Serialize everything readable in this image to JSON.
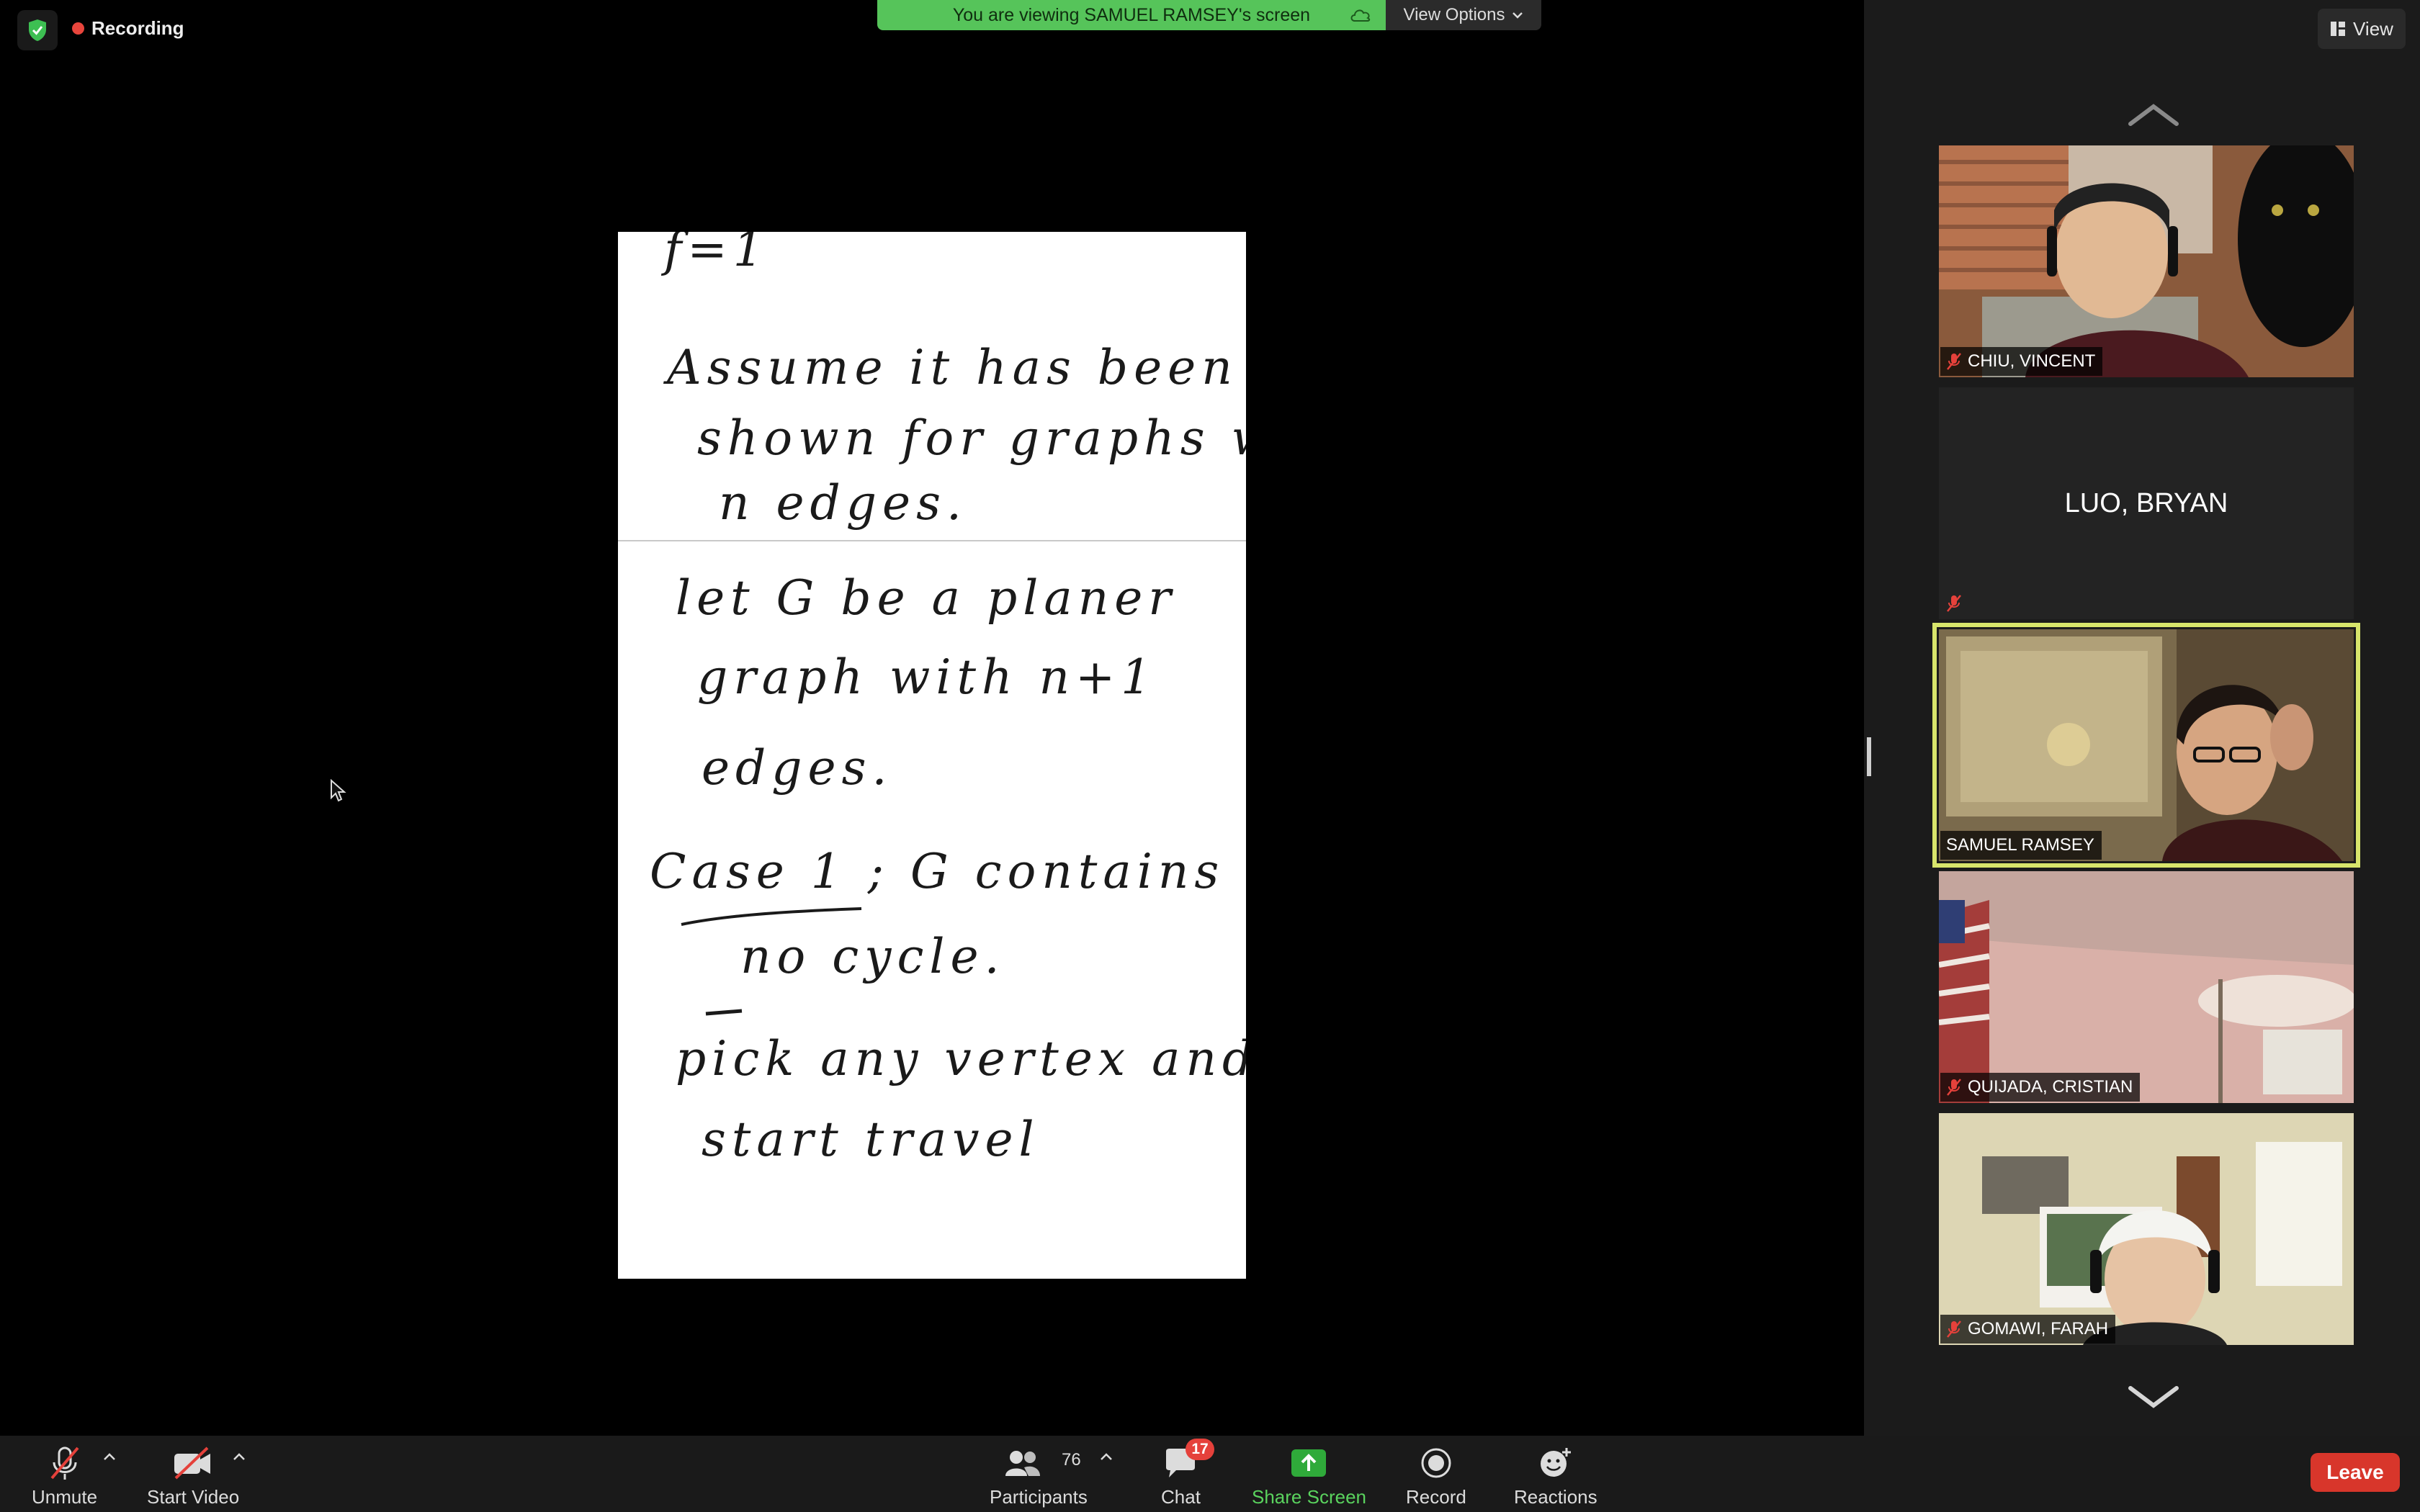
{
  "app": {
    "recording_label": "Recording",
    "banner_text": "You are viewing SAMUEL RAMSEY's screen",
    "view_options_label": "View Options",
    "view_button_label": "View"
  },
  "shared_screen": {
    "handwritten_lines": [
      "f=1",
      "Assume it has been",
      "shown for graphs with",
      "n edges.",
      "let G be a planer",
      "graph with n+1",
      "edges.",
      "Case 1 ; G contains",
      "no cycle.",
      "pick any vertex and",
      "start travel"
    ]
  },
  "participants": [
    {
      "name": "CHIU, VINCENT",
      "muted": true,
      "video": true,
      "active": false
    },
    {
      "name": "LUO, BRYAN",
      "muted": true,
      "video": false,
      "active": false
    },
    {
      "name": "SAMUEL RAMSEY",
      "muted": false,
      "video": true,
      "active": true
    },
    {
      "name": "QUIJADA, CRISTIAN",
      "muted": true,
      "video": true,
      "active": false
    },
    {
      "name": "GOMAWI, FARAH",
      "muted": true,
      "video": true,
      "active": false
    }
  ],
  "toolbar": {
    "unmute_label": "Unmute",
    "start_video_label": "Start Video",
    "participants_label": "Participants",
    "participants_count": "76",
    "chat_label": "Chat",
    "chat_badge": "17",
    "share_label": "Share Screen",
    "record_label": "Record",
    "reactions_label": "Reactions",
    "leave_label": "Leave"
  },
  "colors": {
    "banner_green": "#56c45a",
    "active_speaker_outline": "#d8e56b",
    "leave_red": "#d8362b",
    "recording_red": "#e8453c",
    "share_green": "#5ad35e"
  }
}
